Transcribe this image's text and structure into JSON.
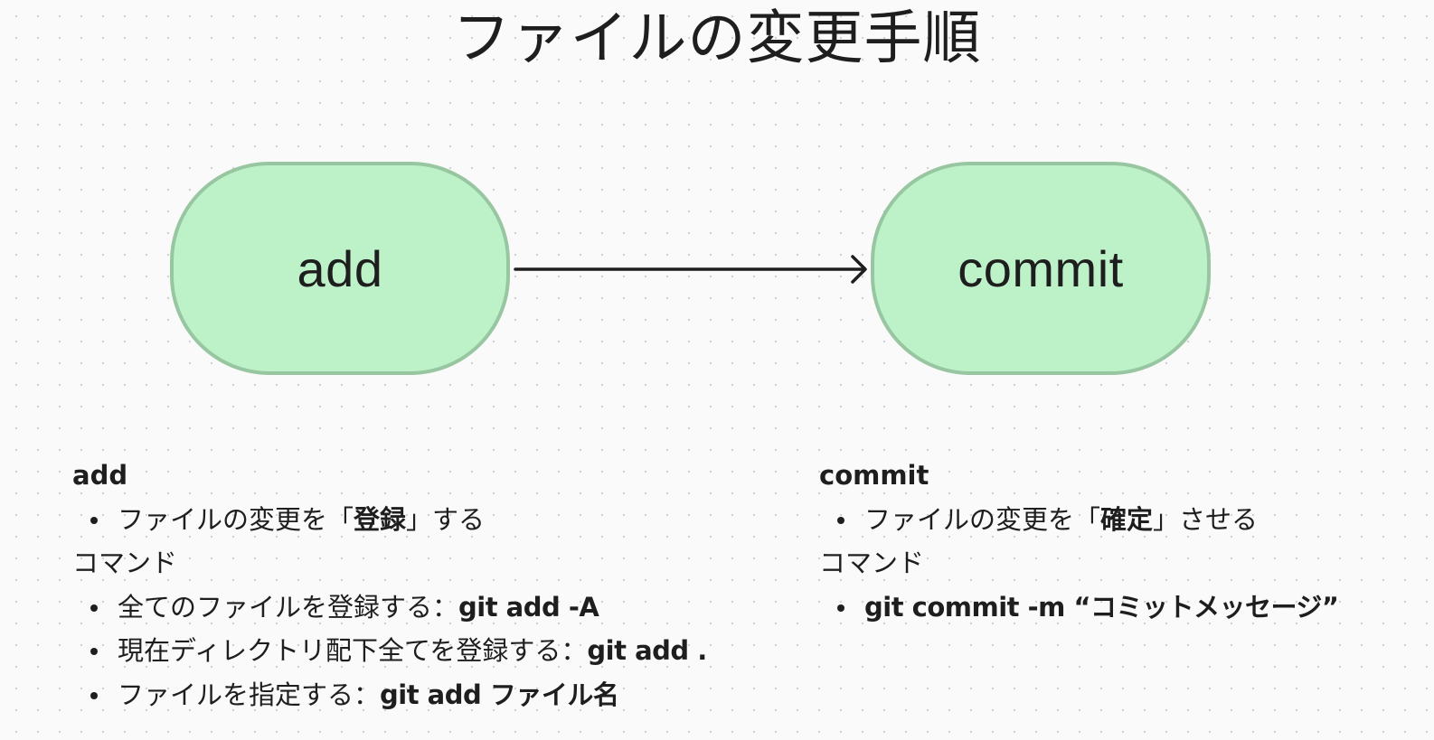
{
  "title": "ファイルの変更手順",
  "colors": {
    "node_fill": "#bdf2c9",
    "node_border": "#97c6a1",
    "text": "#1e1e1e",
    "background": "#fafafa"
  },
  "flow": {
    "nodes": [
      {
        "id": "add",
        "label": "add"
      },
      {
        "id": "commit",
        "label": "commit"
      }
    ],
    "edges": [
      {
        "from": "add",
        "to": "commit"
      }
    ]
  },
  "add_section": {
    "heading": "add",
    "bullet": {
      "pre": "ファイルの変更を「",
      "bold": "登録",
      "post": "」する"
    },
    "command_label": "コマンド",
    "commands": [
      {
        "text": "全てのファイルを登録する：",
        "command": "git add -A"
      },
      {
        "text": "現在ディレクトリ配下全てを登録する：",
        "command": "git add ."
      },
      {
        "text": "ファイルを指定する：",
        "command": "git add ファイル名"
      }
    ]
  },
  "commit_section": {
    "heading": "commit",
    "bullet": {
      "pre": "ファイルの変更を「",
      "bold": "確定",
      "post": "」させる"
    },
    "command_label": "コマンド",
    "commands": [
      {
        "text": "",
        "command": "git commit -m “コミットメッセージ”"
      }
    ]
  }
}
